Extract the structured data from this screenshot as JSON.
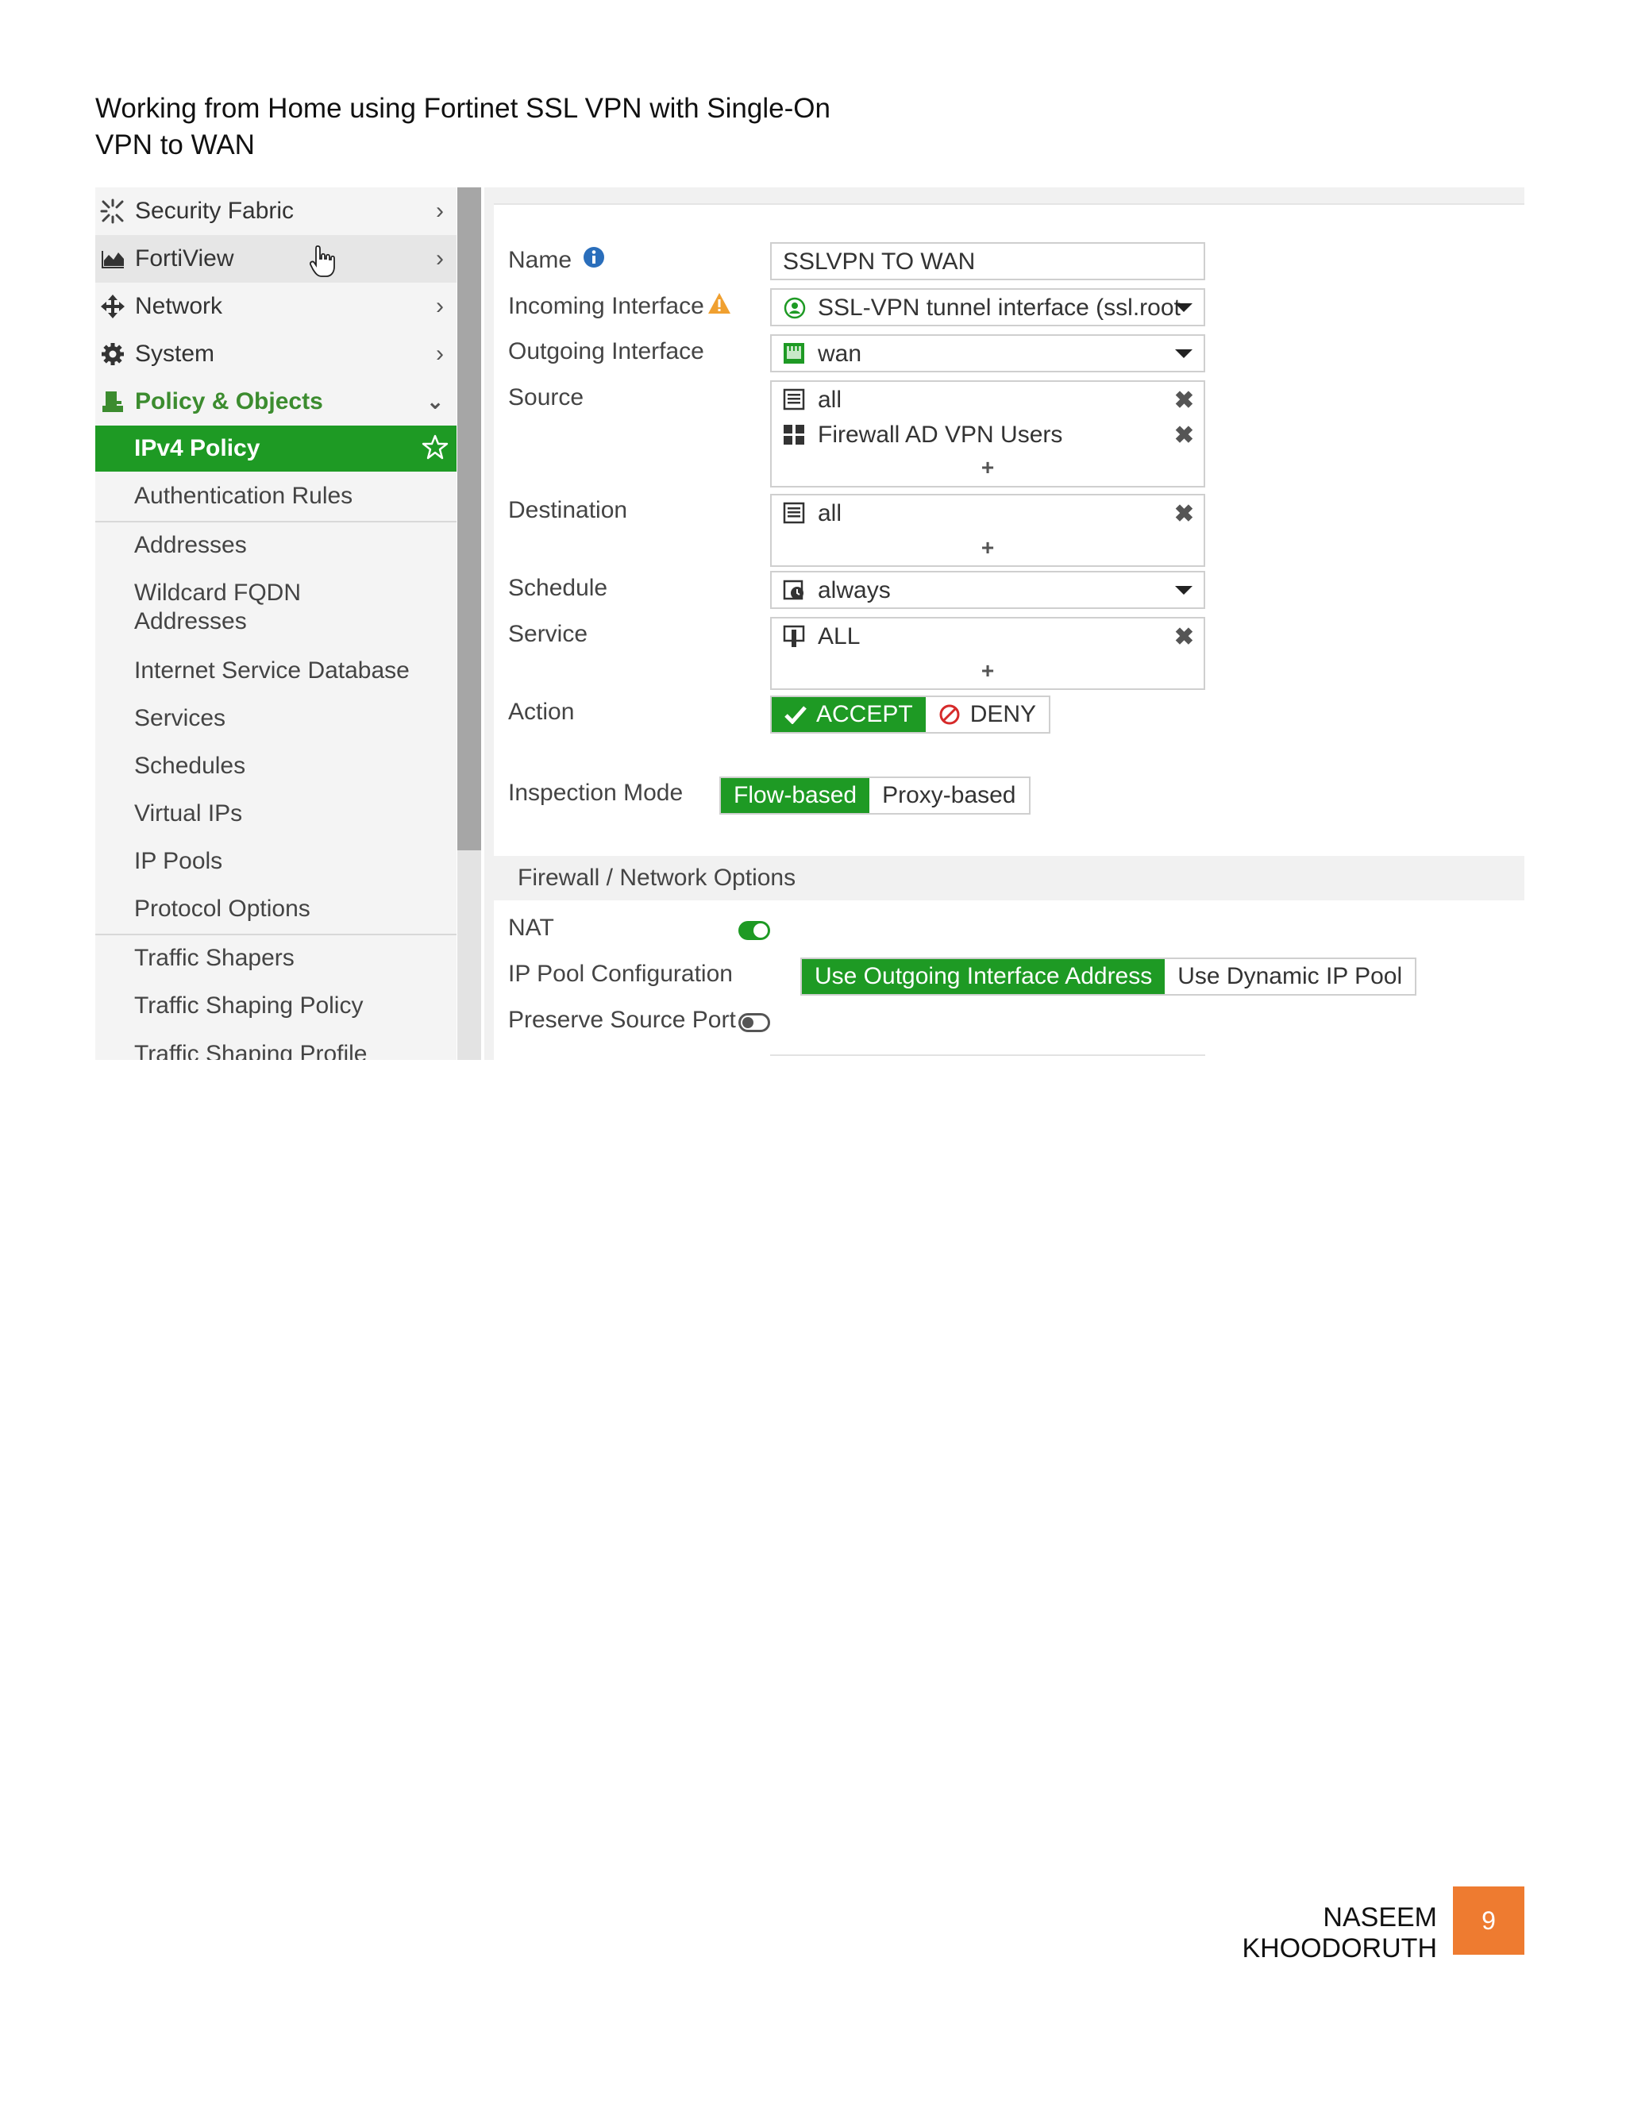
{
  "document": {
    "title": "Working from Home using Fortinet SSL VPN with Single-On VPN to WAN",
    "author": "NASEEM KHOODORUTH",
    "page_number": "9"
  },
  "sidebar": {
    "top_items": [
      {
        "label": "Security Fabric",
        "icon": "security-fabric-icon"
      },
      {
        "label": "FortiView",
        "icon": "fortiview-chart-icon"
      },
      {
        "label": "Network",
        "icon": "network-arrows-icon"
      },
      {
        "label": "System",
        "icon": "gear-icon"
      }
    ],
    "section": {
      "label": "Policy & Objects",
      "icon": "policy-objects-icon"
    },
    "active_item": {
      "label": "IPv4 Policy"
    },
    "sub_items": [
      "Authentication Rules",
      "Addresses",
      "Wildcard FQDN Addresses",
      "Internet Service Database",
      "Services",
      "Schedules",
      "Virtual IPs",
      "IP Pools",
      "Protocol Options",
      "Traffic Shapers",
      "Traffic Shaping Policy",
      "Traffic Shaping Profile"
    ],
    "colors": {
      "active": "#1e9a24",
      "section_text": "#3c8c2f"
    }
  },
  "form": {
    "name": {
      "label": "Name",
      "value": "SSLVPN TO WAN"
    },
    "incoming": {
      "label": "Incoming Interface",
      "value": "SSL-VPN tunnel interface (ssl.root"
    },
    "outgoing": {
      "label": "Outgoing Interface",
      "value": "wan"
    },
    "source": {
      "label": "Source",
      "entries": [
        "all",
        "Firewall AD VPN Users"
      ],
      "add": "+"
    },
    "destination": {
      "label": "Destination",
      "entries": [
        "all"
      ],
      "add": "+"
    },
    "schedule": {
      "label": "Schedule",
      "value": "always"
    },
    "service": {
      "label": "Service",
      "entries": [
        "ALL"
      ],
      "add": "+"
    },
    "action": {
      "label": "Action",
      "accept": "ACCEPT",
      "deny": "DENY",
      "selected": "ACCEPT"
    },
    "inspection": {
      "label": "Inspection Mode",
      "flow": "Flow-based",
      "proxy": "Proxy-based",
      "selected": "Flow-based"
    },
    "section_title": "Firewall / Network Options",
    "nat": {
      "label": "NAT",
      "enabled": true
    },
    "ip_pool": {
      "label": "IP Pool Configuration",
      "outgoing": "Use Outgoing Interface Address",
      "dynamic": "Use Dynamic IP Pool",
      "selected": "Use Outgoing Interface Address"
    },
    "preserve_port": {
      "label": "Preserve Source Port",
      "enabled": false
    }
  },
  "colors": {
    "accent_green": "#1e9a24",
    "page_badge": "#ee7b30",
    "warning": "#f0a030",
    "info": "#2a6ebb",
    "deny_red": "#d62a2a"
  }
}
